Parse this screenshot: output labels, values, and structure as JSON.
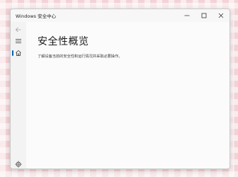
{
  "window": {
    "title": "Windows 安全中心",
    "controls": {
      "minimize_icon": "minimize-icon",
      "maximize_icon": "maximize-icon",
      "close_icon": "close-icon"
    }
  },
  "sidebar": {
    "back_icon": "back-arrow-icon",
    "menu_icon": "hamburger-menu-icon",
    "items": [
      {
        "icon": "home-icon",
        "active": true
      }
    ],
    "settings_icon": "gear-icon",
    "accent_color": "#005fb8"
  },
  "main": {
    "page_title": "安全性概览",
    "description": "了解设备当前的安全性和运行情况并采取必要操作。"
  }
}
